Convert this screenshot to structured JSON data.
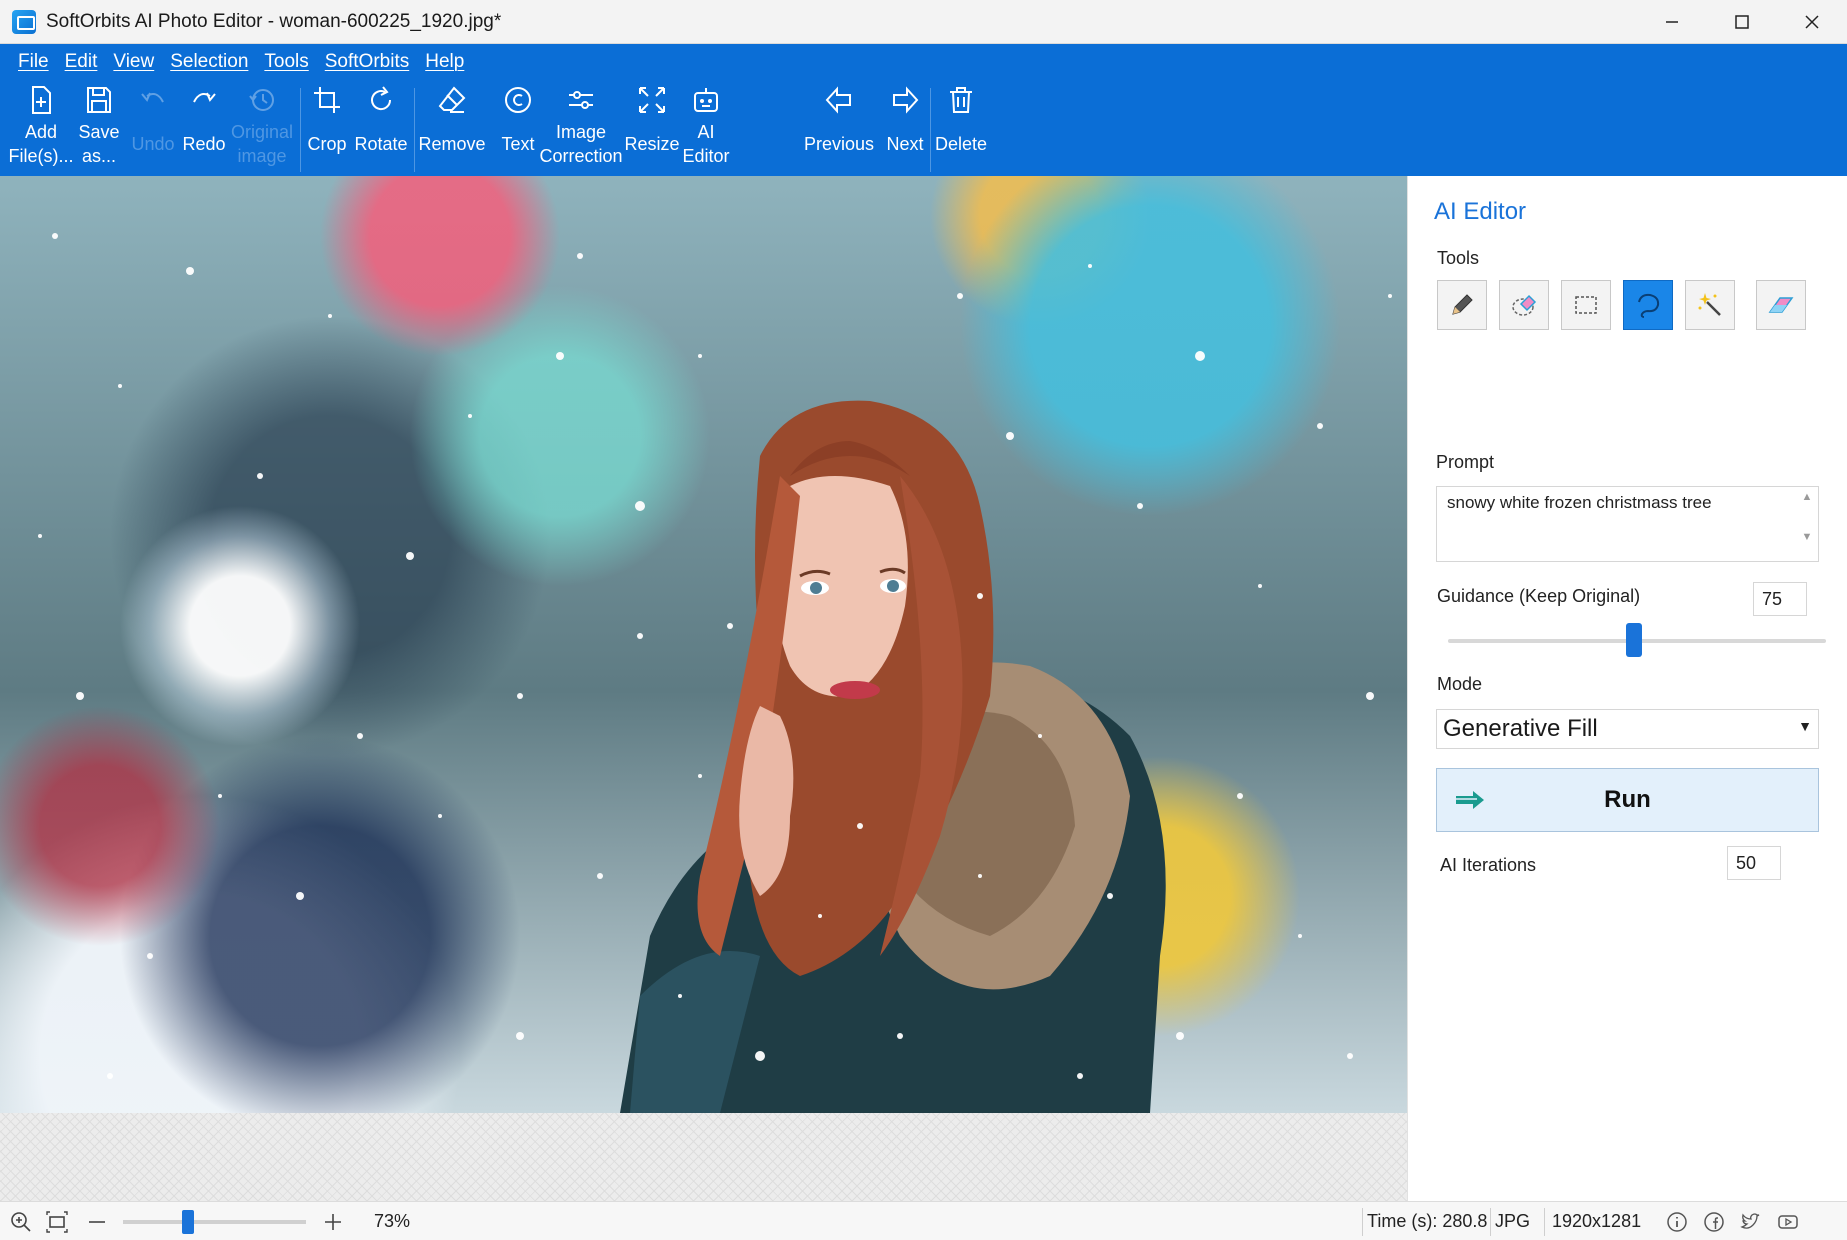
{
  "window": {
    "title": "SoftOrbits AI Photo Editor - woman-600225_1920.jpg*",
    "controls": [
      "minimize",
      "maximize",
      "close"
    ]
  },
  "menu": [
    "File",
    "Edit",
    "View",
    "Selection",
    "Tools",
    "SoftOrbits",
    "Help"
  ],
  "toolbar": {
    "add_files": "Add\nFile(s)...",
    "save_as": "Save\nas...",
    "undo": "Undo",
    "redo": "Redo",
    "original_image": "Original\nimage",
    "crop": "Crop",
    "rotate": "Rotate",
    "remove": "Remove",
    "text": "Text",
    "image_correction": "Image\nCorrection",
    "resize": "Resize",
    "ai_editor": "AI\nEditor",
    "previous": "Previous",
    "next": "Next",
    "delete": "Delete"
  },
  "panel": {
    "title": "AI Editor",
    "tools_label": "Tools",
    "tools": [
      "pencil-icon",
      "lasso-eraser-icon",
      "rect-select-icon",
      "lasso-icon",
      "magic-wand-icon",
      "eraser-icon"
    ],
    "active_tool": "lasso-icon",
    "prompt_label": "Prompt",
    "prompt_value": "snowy white frozen christmass tree",
    "guidance_label": "Guidance (Keep Original)",
    "guidance_value": "75",
    "guidance_level": 50,
    "mode_label": "Mode",
    "mode_value": "Generative Fill",
    "run_label": "Run",
    "iterations_label": "AI Iterations",
    "iterations_value": "50"
  },
  "status": {
    "zoom": "73%",
    "zoom_level": 0.3,
    "time": "Time (s): 280.8",
    "format": "JPG",
    "dimensions": "1920x1281"
  },
  "colors": {
    "accent": "#0b6ed6",
    "active_tool": "#1a86e8",
    "panel_title": "#1a73d9"
  }
}
